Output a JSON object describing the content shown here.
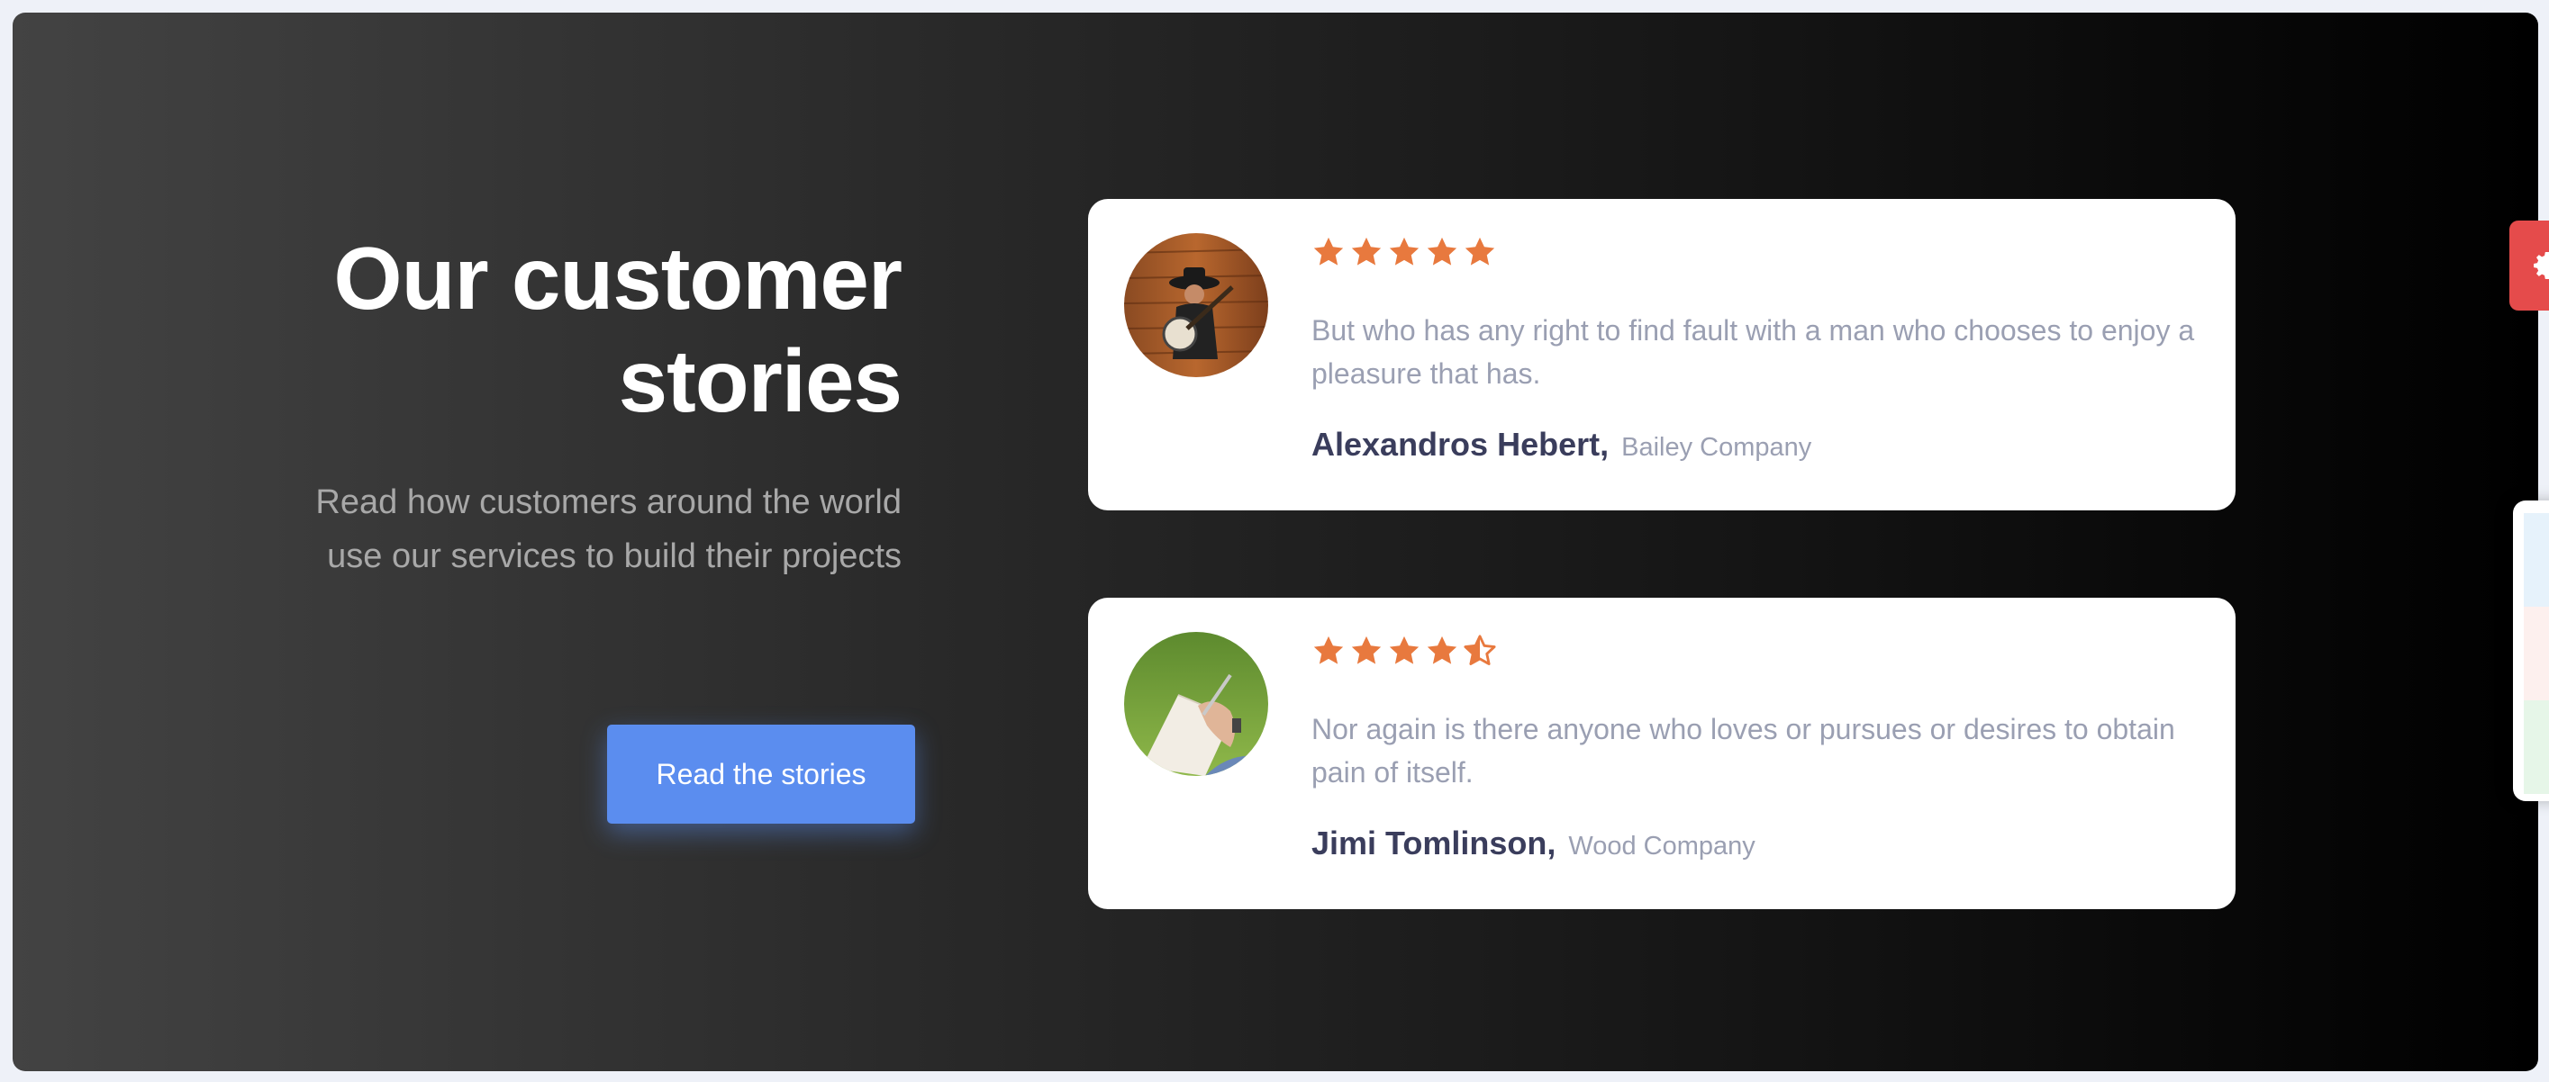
{
  "hero": {
    "title_line1": "Our customer",
    "title_line2": "stories",
    "description": "Read how customers around the world use our services to build their projects",
    "cta_label": "Read the stories"
  },
  "testimonials": [
    {
      "rating": 5,
      "quote": "But who has any right to find fault with a man who chooses to enjoy a pleasure that has.",
      "name": "Alexandros Hebert",
      "company": "Bailey Company"
    },
    {
      "rating": 4.5,
      "quote": "Nor again is there anyone who loves or pursues or desires to obtain pain of itself.",
      "name": "Jimi Tomlinson",
      "company": "Wood Company"
    }
  ],
  "colors": {
    "accent": "#5b8def",
    "star": "#e8793e",
    "settings_tab": "#e54b4b"
  },
  "icons": {
    "rating": "star-icon",
    "settings": "gear-icon"
  }
}
